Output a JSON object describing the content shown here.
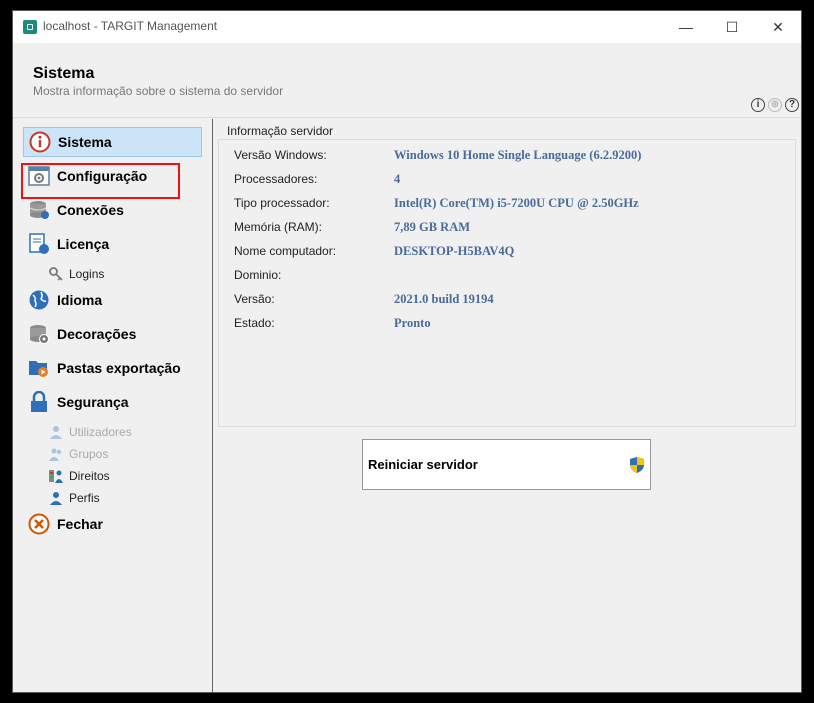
{
  "window": {
    "title": "localhost - TARGIT Management",
    "controls": {
      "minimize": "—",
      "maximize": "☐",
      "close": "✕"
    }
  },
  "header": {
    "title": "Sistema",
    "subtitle": "Mostra informação sobre o sistema do servidor",
    "icons": [
      "info-icon",
      "globe-icon",
      "help-icon"
    ]
  },
  "sidebar": {
    "items": [
      {
        "label": "Sistema",
        "icon": "info-icon",
        "active": true
      },
      {
        "label": "Configuração",
        "icon": "settings-window-icon"
      },
      {
        "label": "Conexões",
        "icon": "database-connections-icon"
      },
      {
        "label": "Licença",
        "icon": "license-icon"
      },
      {
        "label": "Logins",
        "icon": "key-icon",
        "sub": true
      },
      {
        "label": "Idioma",
        "icon": "globe-icon"
      },
      {
        "label": "Decorações",
        "icon": "decorations-icon"
      },
      {
        "label": "Pastas exportação",
        "icon": "export-folder-icon"
      },
      {
        "label": "Segurança",
        "icon": "lock-icon"
      },
      {
        "label": "Utilizadores",
        "icon": "user-icon",
        "sub": true,
        "disabled": true
      },
      {
        "label": "Grupos",
        "icon": "group-icon",
        "sub": true,
        "disabled": true
      },
      {
        "label": "Direitos",
        "icon": "rights-icon",
        "sub": true
      },
      {
        "label": "Perfis",
        "icon": "profile-icon",
        "sub": true
      },
      {
        "label": "Fechar",
        "icon": "close-circle-icon"
      }
    ]
  },
  "server_info": {
    "group_title": "Informação servidor",
    "rows": [
      {
        "label": "Versão Windows:",
        "value": "Windows 10 Home Single Language (6.2.9200)"
      },
      {
        "label": "Processadores:",
        "value": "4"
      },
      {
        "label": "Tipo processador:",
        "value": "Intel(R) Core(TM) i5-7200U CPU @ 2.50GHz"
      },
      {
        "label": "Memória (RAM):",
        "value": "7,89 GB RAM"
      },
      {
        "label": "Nome computador:",
        "value": "DESKTOP-H5BAV4Q"
      },
      {
        "label": "Dominio:",
        "value": ""
      },
      {
        "label": "Versão:",
        "value": "2021.0 build 19194"
      },
      {
        "label": "Estado:",
        "value": "Pronto"
      }
    ]
  },
  "actions": {
    "restart_label": "Reiniciar servidor"
  },
  "colors": {
    "active_bg": "#cce4f7",
    "value_text": "#4a6a9c",
    "highlight": "#e11111"
  }
}
